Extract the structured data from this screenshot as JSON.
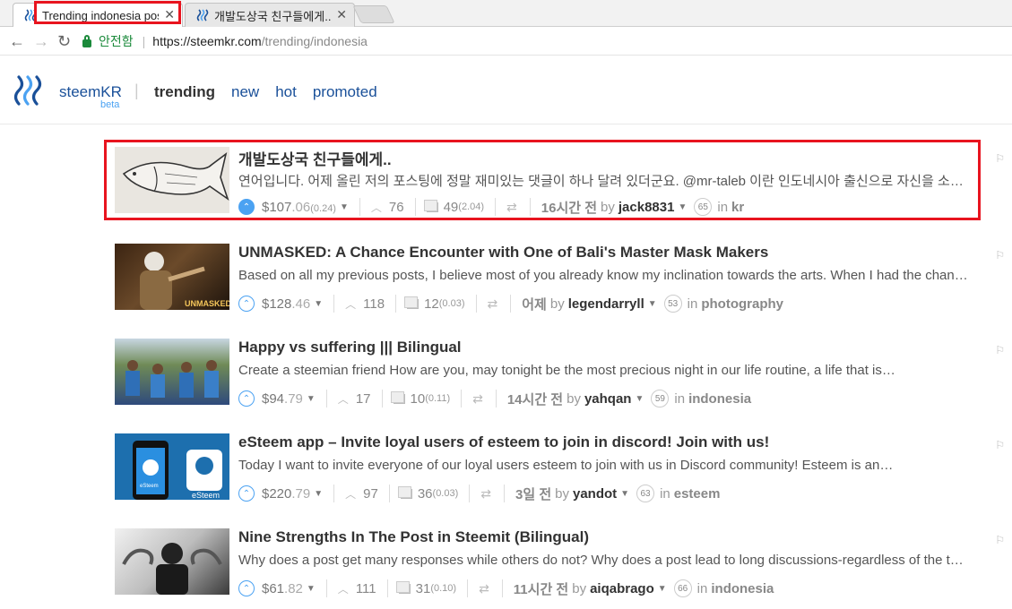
{
  "browser": {
    "tabs": [
      {
        "title": "Trending indonesia post"
      },
      {
        "title": "개발도상국 친구들에게.."
      }
    ],
    "secure_label": "안전함",
    "url_host": "https://steemkr.com",
    "url_path": "/trending/indonesia"
  },
  "site": {
    "brand": "steemKR",
    "beta": "beta",
    "nav": {
      "trending": "trending",
      "new": "new",
      "hot": "hot",
      "promoted": "promoted"
    }
  },
  "posts": [
    {
      "title": "개발도상국 친구들에게..",
      "body": "연어입니다. 어제 올린 저의 포스팅에 정말 재미있는 댓글이 하나 달려 있더군요. @mr-taleb 이란 인도네시아 출신으로 자신을 소개한 분의 댓글이었는데요",
      "payout_main": "$107",
      "payout_cents": ".06",
      "payout_pending": "(0.24)",
      "votes": "76",
      "comments": "49",
      "comments_extra": "(2.04)",
      "time": "16시간 전",
      "by": "by",
      "author": "jack8831",
      "rep": "65",
      "in": "in",
      "category": "kr"
    },
    {
      "title": "UNMASKED: A Chance Encounter with One of Bali's Master Mask Makers",
      "body": "Based on all my previous posts, I believe most of you already know my inclination towards the arts. When I had the chance to visit Bali",
      "payout_main": "$128",
      "payout_cents": ".46",
      "payout_pending": "",
      "votes": "118",
      "comments": "12",
      "comments_extra": "(0.03)",
      "time": "어제",
      "by": "by",
      "author": "legendarryll",
      "rep": "53",
      "in": "in",
      "category": "photography",
      "thumb_text": "UNMASKED"
    },
    {
      "title": "Happy vs suffering ||| Bilingual",
      "body": "Create a steemian friend How are you, may tonight be the most precious night in our life routine, a life that is…",
      "payout_main": "$94",
      "payout_cents": ".79",
      "payout_pending": "",
      "votes": "17",
      "comments": "10",
      "comments_extra": "(0.11)",
      "time": "14시간 전",
      "by": "by",
      "author": "yahqan",
      "rep": "59",
      "in": "in",
      "category": "indonesia"
    },
    {
      "title": "eSteem app – Invite loyal users of esteem to join in discord! Join with us!",
      "body": "Today I want to invite everyone of our loyal users esteem to join with us in Discord community! Esteem is an…",
      "payout_main": "$220",
      "payout_cents": ".79",
      "payout_pending": "",
      "votes": "97",
      "comments": "36",
      "comments_extra": "(0.03)",
      "time": "3일 전",
      "by": "by",
      "author": "yandot",
      "rep": "63",
      "in": "in",
      "category": "esteem",
      "thumb_text_a": "eSteem",
      "thumb_text_b": "eSteem"
    },
    {
      "title": "Nine Strengths In The Post in Steemit (Bilingual)",
      "body": "Why does a post get many responses while others do not? Why does a post lead to long discussions-regardless of the topic",
      "payout_main": "$61",
      "payout_cents": ".82",
      "payout_pending": "",
      "votes": "111",
      "comments": "31",
      "comments_extra": "(0.10)",
      "time": "11시간 전",
      "by": "by",
      "author": "aiqabrago",
      "rep": "66",
      "in": "in",
      "category": "indonesia"
    }
  ]
}
